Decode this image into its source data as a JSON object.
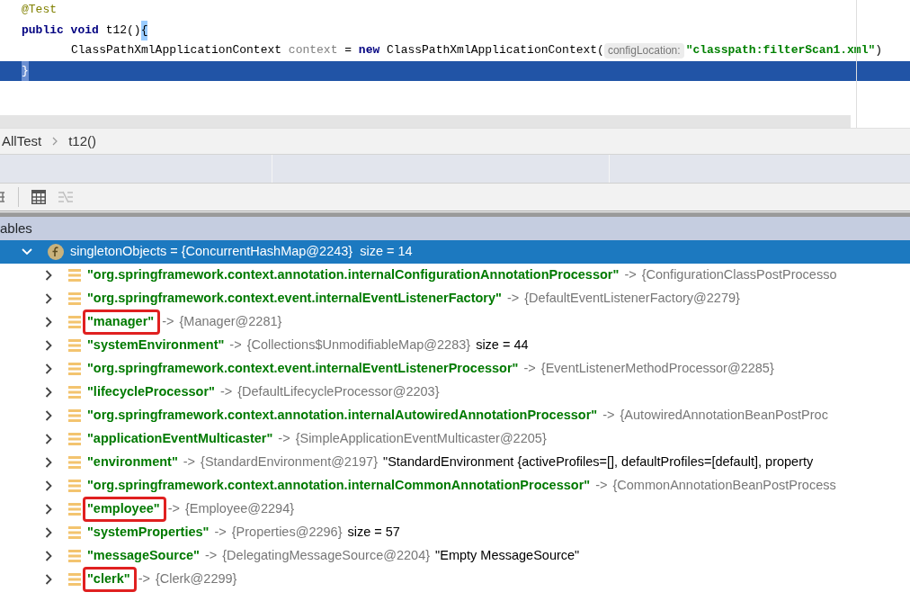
{
  "editor": {
    "lines": [
      {
        "selected": false,
        "indent": false,
        "tokens": [
          {
            "kind": "annotation",
            "text": "@Test"
          }
        ]
      },
      {
        "selected": false,
        "indent": false,
        "tokens": [
          {
            "kind": "keyword",
            "text": "public void "
          },
          {
            "kind": "plain",
            "text": "t12()"
          },
          {
            "kind": "brace",
            "text": "{"
          }
        ]
      },
      {
        "selected": false,
        "indent": true,
        "tokens": [
          {
            "kind": "plain",
            "text": "ClassPathXmlApplicationContext "
          },
          {
            "kind": "unused",
            "text": "context"
          },
          {
            "kind": "plain",
            "text": " = "
          },
          {
            "kind": "keyword",
            "text": "new"
          },
          {
            "kind": "plain",
            "text": " ClassPathXmlApplicationContext("
          },
          {
            "kind": "hint",
            "text": "configLocation:"
          },
          {
            "kind": "string",
            "text": "\"classpath:filterScan1.xml\""
          },
          {
            "kind": "plain",
            "text": ")"
          }
        ]
      },
      {
        "selected": true,
        "indent": false,
        "tokens": [
          {
            "kind": "brace",
            "text": "}"
          }
        ]
      }
    ]
  },
  "breadcrumb": [
    "AllTest",
    "t12()"
  ],
  "panel_title": "ables",
  "tree": {
    "name": "singletonObjects",
    "value": " = {ConcurrentHashMap@2243}",
    "extra": "size = 14",
    "expanded": true,
    "selected": true,
    "children": [
      {
        "key": "\"org.springframework.context.annotation.internalConfigurationAnnotationProcessor\"",
        "value": "{ConfigurationClassPostProcesso",
        "arrow": "->",
        "highlighted": false
      },
      {
        "key": "\"org.springframework.context.event.internalEventListenerFactory\"",
        "value": "{DefaultEventListenerFactory@2279}",
        "arrow": "->",
        "highlighted": false
      },
      {
        "key": "\"manager\"",
        "value": "{Manager@2281}",
        "arrow": "->",
        "highlighted": true
      },
      {
        "key": "\"systemEnvironment\"",
        "value": "{Collections$UnmodifiableMap@2283}",
        "extra": "size = 44",
        "arrow": "->",
        "highlighted": false
      },
      {
        "key": "\"org.springframework.context.event.internalEventListenerProcessor\"",
        "value": "{EventListenerMethodProcessor@2285}",
        "arrow": "->",
        "highlighted": false
      },
      {
        "key": "\"lifecycleProcessor\"",
        "value": "{DefaultLifecycleProcessor@2203}",
        "arrow": "->",
        "highlighted": false
      },
      {
        "key": "\"org.springframework.context.annotation.internalAutowiredAnnotationProcessor\"",
        "value": "{AutowiredAnnotationBeanPostProc",
        "arrow": "->",
        "highlighted": false
      },
      {
        "key": "\"applicationEventMulticaster\"",
        "value": "{SimpleApplicationEventMulticaster@2205}",
        "arrow": "->",
        "highlighted": false
      },
      {
        "key": "\"environment\"",
        "value": "{StandardEnvironment@2197}",
        "extra": "\"StandardEnvironment {activeProfiles=[], defaultProfiles=[default], property",
        "arrow": "->",
        "highlighted": false
      },
      {
        "key": "\"org.springframework.context.annotation.internalCommonAnnotationProcessor\"",
        "value": "{CommonAnnotationBeanPostProcess",
        "arrow": "->",
        "highlighted": false
      },
      {
        "key": "\"employee\"",
        "value": "{Employee@2294}",
        "arrow": "->",
        "highlighted": true
      },
      {
        "key": "\"systemProperties\"",
        "value": "{Properties@2296}",
        "extra": "size = 57",
        "arrow": "->",
        "highlighted": false
      },
      {
        "key": "\"messageSource\"",
        "value": "{DelegatingMessageSource@2204}",
        "extra": "\"Empty MessageSource\"",
        "arrow": "->",
        "highlighted": false
      },
      {
        "key": "\"clerk\"",
        "value": "{Clerk@2299}",
        "arrow": "->",
        "highlighted": true
      }
    ]
  }
}
